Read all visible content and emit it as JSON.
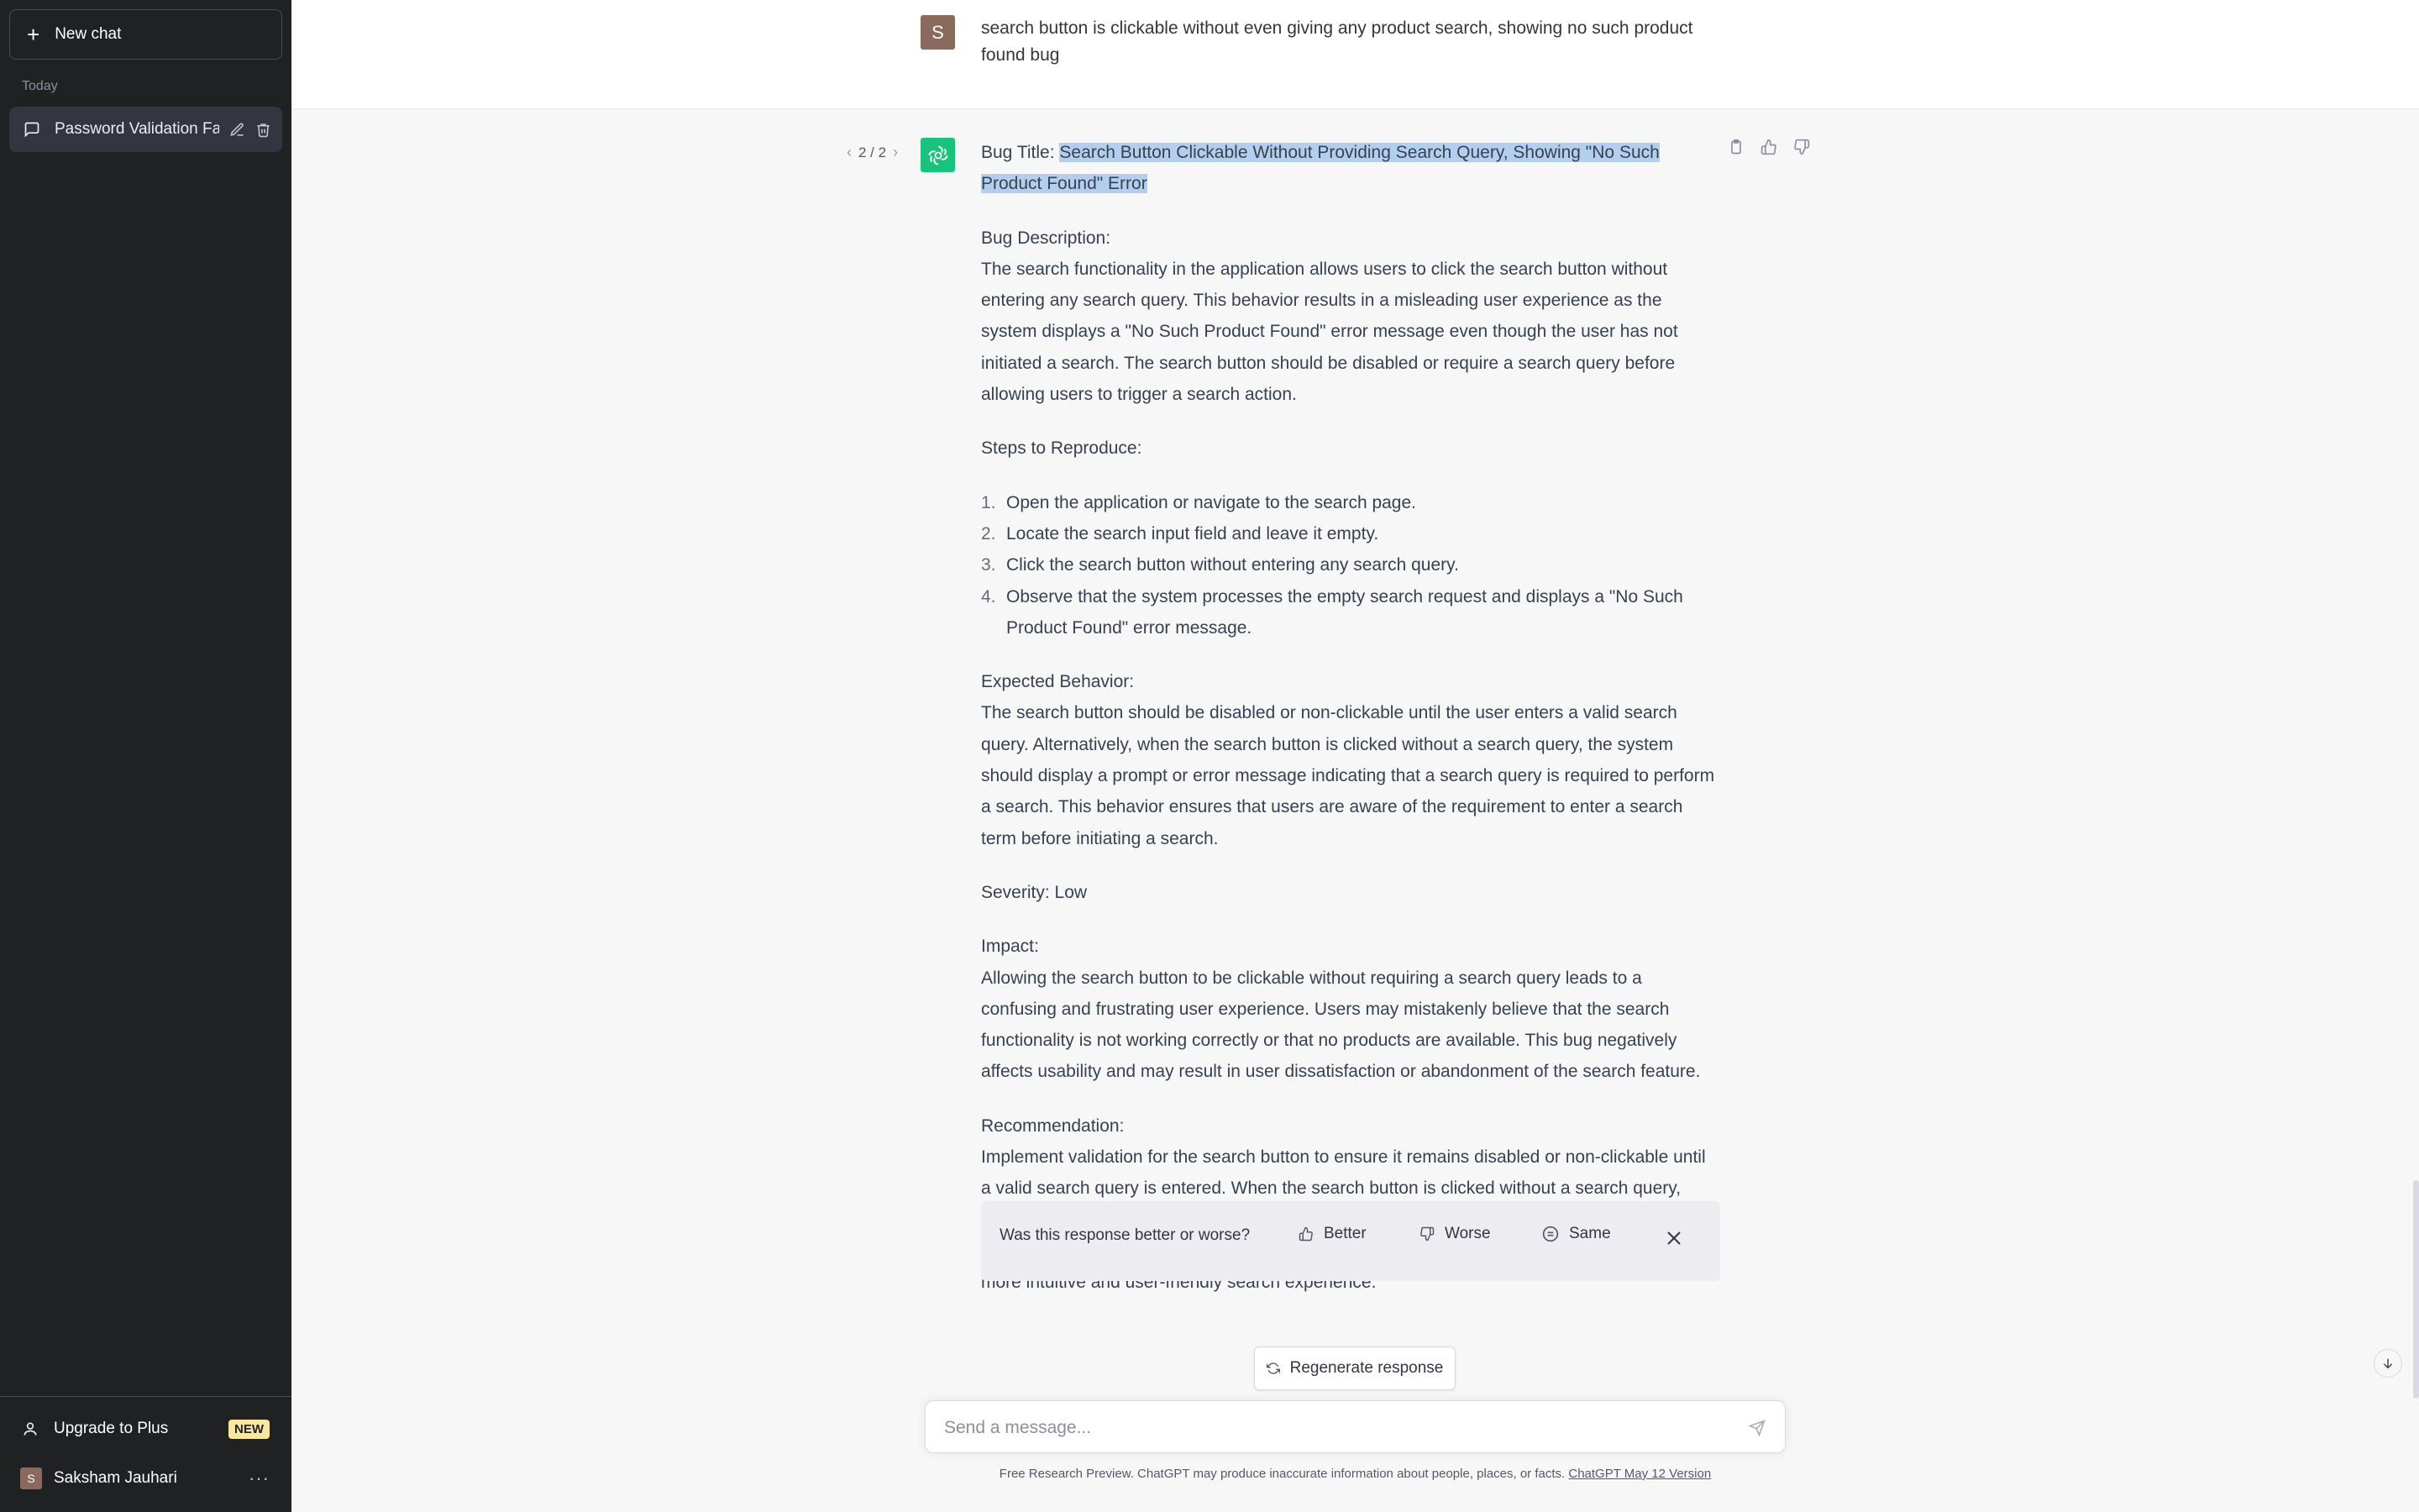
{
  "sidebar": {
    "new_chat_label": "New chat",
    "section_label": "Today",
    "conversations": [
      {
        "title": "Password Validation Fai"
      }
    ],
    "upgrade_label": "Upgrade to Plus",
    "upgrade_badge": "NEW",
    "user_initial": "S",
    "user_name": "Saksham Jauhari"
  },
  "user_message": {
    "avatar_initial": "S",
    "text": "search button is clickable without even giving any product search, showing no such product found bug"
  },
  "assistant_message": {
    "pager": "2 / 2",
    "title_prefix": "Bug Title: ",
    "title_highlight": "Search Button Clickable Without Providing Search Query, Showing \"No Such Product Found\" Error",
    "desc_heading": "Bug Description:",
    "desc_text": "The search functionality in the application allows users to click the search button without entering any search query. This behavior results in a misleading user experience as the system displays a \"No Such Product Found\" error message even though the user has not initiated a search. The search button should be disabled or require a search query before allowing users to trigger a search action.",
    "steps_heading": "Steps to Reproduce:",
    "steps": [
      {
        "num": "1.",
        "text": "Open the application or navigate to the search page."
      },
      {
        "num": "2.",
        "text": "Locate the search input field and leave it empty."
      },
      {
        "num": "3.",
        "text": "Click the search button without entering any search query."
      },
      {
        "num": "4.",
        "text": "Observe that the system processes the empty search request and displays a \"No Such Product Found\" error message."
      }
    ],
    "expected_heading": "Expected Behavior:",
    "expected_text": "The search button should be disabled or non-clickable until the user enters a valid search query. Alternatively, when the search button is clicked without a search query, the system should display a prompt or error message indicating that a search query is required to perform a search. This behavior ensures that users are aware of the requirement to enter a search term before initiating a search.",
    "severity": "Severity: Low",
    "impact_heading": "Impact:",
    "impact_text": "Allowing the search button to be clickable without requiring a search query leads to a confusing and frustrating user experience. Users may mistakenly believe that the search functionality is not working correctly or that no products are available. This bug negatively affects usability and may result in user dissatisfaction or abandonment of the search feature.",
    "recommendation_heading": "Recommendation:",
    "recommendation_text": "Implement validation for the search button to ensure it remains disabled or non-clickable until a valid search query is entered. When the search button is clicked without a search query, display a prompt or error message informing the user that a search term is required. By enforcing this validation, the system can prevent misleading error messages and provide a more intuitive and user-friendly search experience."
  },
  "feedback": {
    "question": "Was this response better or worse?",
    "better_label": "Better",
    "worse_label": "Worse",
    "same_label": "Same"
  },
  "regenerate_label": "Regenerate response",
  "composer": {
    "placeholder": "Send a message..."
  },
  "footer": {
    "text": "Free Research Preview. ChatGPT may produce inaccurate information about people, places, or facts. ",
    "link_text": "ChatGPT May 12 Version"
  },
  "colors": {
    "sidebar_bg": "#202123",
    "assistant_avatar": "#19c37d",
    "user_avatar": "#8a6a5d",
    "highlight": "#b4cfee",
    "badge": "#fae69e"
  }
}
